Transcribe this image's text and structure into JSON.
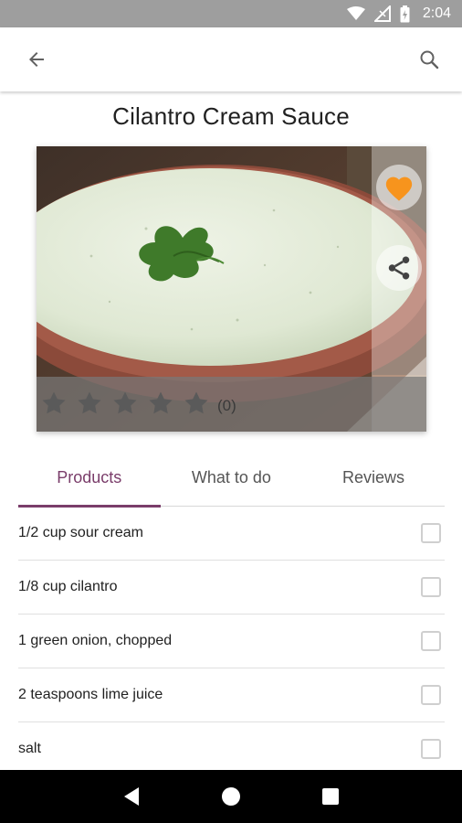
{
  "status_bar": {
    "time": "2:04",
    "icons": [
      "wifi-icon",
      "signal-icon",
      "battery-icon"
    ]
  },
  "toolbar": {
    "back_icon": "arrow-left-icon",
    "search_icon": "search-icon"
  },
  "recipe": {
    "title": "Cilantro Cream Sauce",
    "favorite_icon": "heart-icon",
    "share_icon": "share-icon",
    "rating": {
      "stars_max": 5,
      "value": 0,
      "count_label": "(0)"
    }
  },
  "tabs": [
    {
      "label": "Products",
      "active": true
    },
    {
      "label": "What to do",
      "active": false
    },
    {
      "label": "Reviews",
      "active": false
    }
  ],
  "ingredients": [
    {
      "text": "1/2 cup sour cream",
      "checked": false
    },
    {
      "text": "1/8 cup cilantro",
      "checked": false
    },
    {
      "text": "1 green onion, chopped",
      "checked": false
    },
    {
      "text": "2 teaspoons lime juice",
      "checked": false
    },
    {
      "text": "salt",
      "checked": false
    }
  ],
  "nav_bar": {
    "icons": [
      "back-triangle-icon",
      "home-circle-icon",
      "recents-square-icon"
    ]
  },
  "colors": {
    "accent": "#7a3d6a",
    "favorite": "#f7941d",
    "status_bar": "#9e9e9e"
  }
}
